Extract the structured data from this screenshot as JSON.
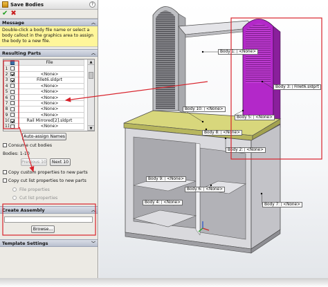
{
  "window": {
    "title": "Save Bodies"
  },
  "actions": {
    "ok_glyph": "✔",
    "cancel_glyph": "✖",
    "help_glyph": "?"
  },
  "message_section": {
    "header": "Message",
    "text": "Double-click a body file name or select a body callout in the graphics area to assign the body to a new file."
  },
  "parts_section": {
    "header": "Resulting Parts",
    "column_file": "File",
    "rows": [
      {
        "num": "1",
        "checked": false,
        "file": ""
      },
      {
        "num": "2",
        "checked": true,
        "file": "<None>"
      },
      {
        "num": "3",
        "checked": true,
        "file": "Fillet6.sldprt"
      },
      {
        "num": "4",
        "checked": false,
        "file": "<None>"
      },
      {
        "num": "5",
        "checked": false,
        "file": "<None>"
      },
      {
        "num": "6",
        "checked": false,
        "file": "<None>"
      },
      {
        "num": "7",
        "checked": false,
        "file": "<None>"
      },
      {
        "num": "8",
        "checked": false,
        "file": "<None>"
      },
      {
        "num": "9",
        "checked": false,
        "file": "<None>"
      },
      {
        "num": "10",
        "checked": true,
        "file": "Rail Mirrored[2].sldprt"
      },
      {
        "num": "11",
        "checked": false,
        "file": "<None>"
      }
    ],
    "auto_assign_label": "Auto-assign Names",
    "consume_label": "Consume cut bodies",
    "bodies_label": "Bodies: 1-10",
    "previous_label": "Previous 10",
    "next_label": "Next 10",
    "copy_custom_label": "Copy custom properties to new parts",
    "copy_cut_list_label": "Copy cut list properties to new parts",
    "file_props_label": "File properties",
    "cut_list_props_label": "Cut list properties"
  },
  "assembly_section": {
    "header": "Create Assembly",
    "path_value": "",
    "browse_label": "Browse..."
  },
  "template_section": {
    "header": "Template Settings"
  },
  "callouts": {
    "body1": {
      "name": "Body 1:",
      "file": "<None>"
    },
    "body3": {
      "name": "Body 3:",
      "file": "Fillet6.sldprt"
    },
    "body10": {
      "name": "Body 10:",
      "file": "<None>"
    },
    "body5": {
      "name": "Body 5:",
      "file": "<None>"
    },
    "body8": {
      "name": "Body 8:",
      "file": "<None>"
    },
    "body2": {
      "name": "Body 2:",
      "file": "<None>"
    },
    "body9": {
      "name": "Body 9:",
      "file": "<None>"
    },
    "body6": {
      "name": "Body 6:",
      "file": "<None>"
    },
    "body4": {
      "name": "Body 4:",
      "file": "<None>"
    },
    "body7": {
      "name": "Body 7:",
      "file": "<None>"
    }
  },
  "colors": {
    "highlight_red": "#d8222b",
    "selected_body_purple": "#b328c9",
    "shelf_top_yellow": "#d8d77c",
    "cabinet_gray": "#d9d9dd",
    "message_yellow": "#fff69a"
  }
}
